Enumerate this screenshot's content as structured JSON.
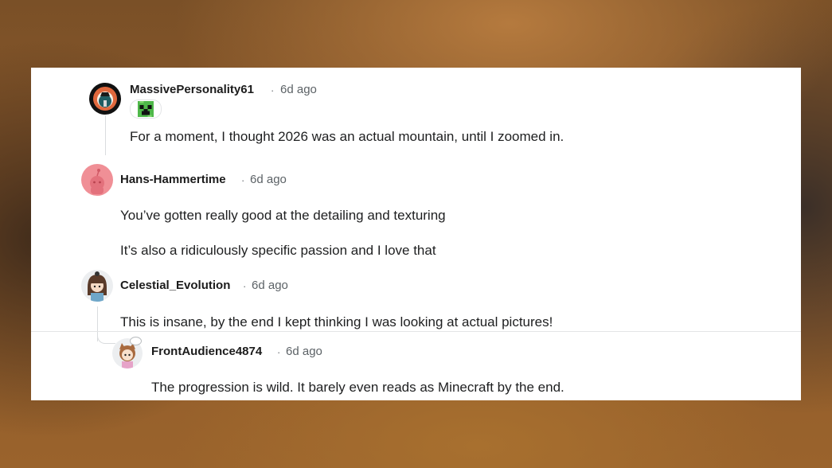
{
  "comments": [
    {
      "author": "MassivePersonality61",
      "separator": "·",
      "time": "6d ago",
      "flair_icon": "creeper-icon",
      "paragraphs": [
        "For a moment, I thought 2026 was an actual mountain, until I zoomed in."
      ]
    },
    {
      "author": "Hans-Hammertime",
      "separator": "·",
      "time": "6d ago",
      "paragraphs": [
        "You’ve gotten really good at the detailing and texturing",
        "It’s also a ridiculously specific passion and I love that"
      ]
    },
    {
      "author": "Celestial_Evolution",
      "separator": "·",
      "time": "6d ago",
      "paragraphs": [
        "This is insane, by the end I kept thinking I was looking at actual pictures!"
      ]
    },
    {
      "author": "FrontAudience4874",
      "separator": "·",
      "time": "6d ago",
      "paragraphs": [
        "The progression is wild. It barely even reads as Minecraft by the end."
      ]
    }
  ],
  "colors": {
    "card_background": "#ffffff",
    "thread_line": "#d9dcde",
    "avatar_pink": "#f08f96",
    "avatar_dark_ring": "#111111"
  }
}
